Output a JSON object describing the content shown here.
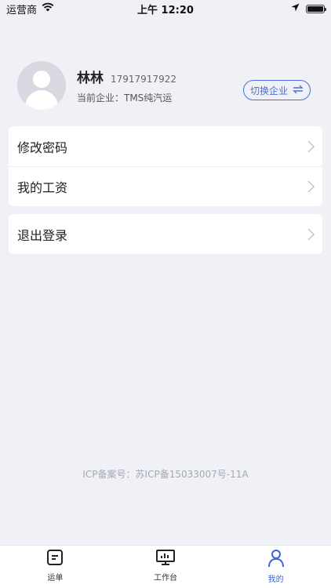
{
  "status_bar": {
    "carrier": "运营商",
    "time": "上午 12:20"
  },
  "profile": {
    "name": "林林",
    "phone": "17917917922",
    "company_label": "当前企业：TMS纯汽运",
    "switch_label": "切换企业"
  },
  "menu": {
    "change_password": "修改密码",
    "my_salary": "我的工资",
    "logout": "退出登录"
  },
  "footer": {
    "icp": "ICP备案号：苏ICP备15033007号-11A"
  },
  "tabbar": {
    "items": [
      {
        "label": "运单",
        "icon": "waybill-icon"
      },
      {
        "label": "工作台",
        "icon": "workbench-icon"
      },
      {
        "label": "我的",
        "icon": "profile-icon"
      }
    ],
    "active_index": 2
  },
  "colors": {
    "accent": "#3a66d6",
    "background": "#f0f1f7"
  }
}
